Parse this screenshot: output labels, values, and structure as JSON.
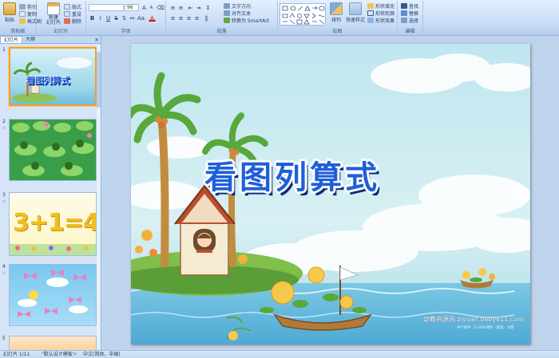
{
  "ribbon": {
    "clipboard": {
      "label": "剪贴板",
      "paste": "粘贴",
      "cut": "剪切",
      "copy": "复制",
      "format_painter": "格式刷"
    },
    "slides": {
      "label": "幻灯片",
      "new_slide": "新建\n幻灯片",
      "layout": "版式",
      "reset": "重设",
      "delete": "删除"
    },
    "font": {
      "label": "字体",
      "font_name": "",
      "font_size": "96"
    },
    "paragraph": {
      "label": "段落",
      "text_direction": "文字方向",
      "align_text": "对齐文本",
      "smartart": "转换为 SmartArt"
    },
    "drawing": {
      "label": "绘图",
      "arrange": "排列",
      "quick_styles": "快速样式",
      "shape_fill": "形状填充",
      "shape_outline": "形状轮廓",
      "shape_effects": "形状效果"
    },
    "editing": {
      "label": "编辑",
      "find": "查找",
      "replace": "替换",
      "select": "选择"
    }
  },
  "pane": {
    "tab_slides": "幻灯片",
    "tab_outline": "大纲",
    "close": "×",
    "thumbnails": [
      {
        "num": "1",
        "star": "",
        "title": "看图列算式",
        "selected": true
      },
      {
        "num": "2",
        "star": "☆"
      },
      {
        "num": "3",
        "star": "☆",
        "equation": "3+1=4"
      },
      {
        "num": "4",
        "star": "☆"
      },
      {
        "num": "5",
        "star": ""
      }
    ]
  },
  "slide": {
    "title": "看图列算式",
    "watermark": "幼教资源网 ziyuan.baby611.com",
    "watermark_sub": "PPT课件 · FLASH课件 · 教案 · 试卷"
  },
  "status": {
    "slide_count": "幻灯片 1/11",
    "theme": "\"默认设计模板\"",
    "language": "中文(简体，中国)"
  },
  "colors": {
    "ribbon": "#c9dcf5",
    "accent": "#1e5fd8",
    "selection": "#f0a030"
  }
}
